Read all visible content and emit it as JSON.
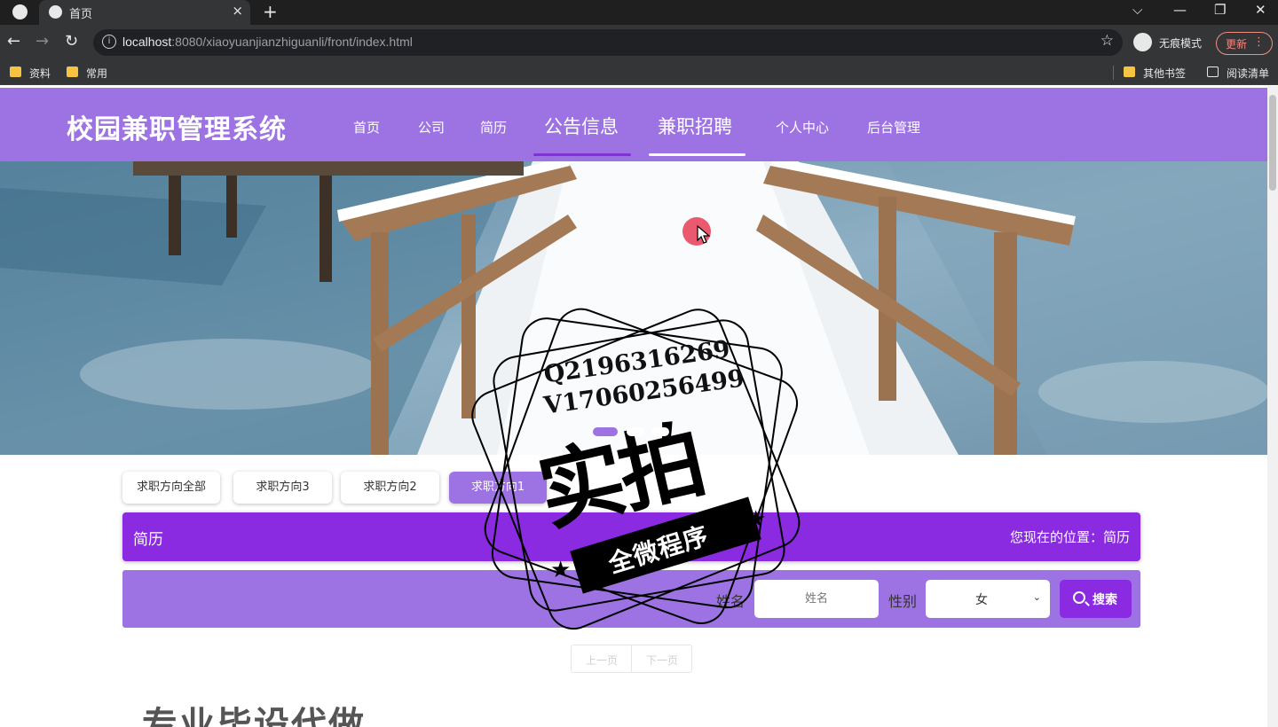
{
  "browser": {
    "tab_title": "首页",
    "tab_close": "×",
    "new_tab": "+",
    "url_host": "localhost",
    "url_rest": ":8080/xiaoyuanjianzhiguanli/front/index.html",
    "info_icon": "i",
    "star_icon": "☆",
    "incognito_label": "无痕模式",
    "update_label": "更新",
    "menu_dots": "⋮",
    "window_controls": [
      "⌵",
      "—",
      "❐",
      "✕"
    ],
    "nav": {
      "back": "←",
      "forward": "→",
      "reload": "↻"
    },
    "bookmarks_left": [
      "资料",
      "常用"
    ],
    "bookmarks_right": [
      "其他书签",
      "阅读清单"
    ]
  },
  "site": {
    "title": "校园兼职管理系统",
    "nav": [
      "首页",
      "公司",
      "简历",
      "公告信息",
      "兼职招聘",
      "个人中心",
      "后台管理"
    ],
    "accent": "#9d73e3",
    "primary": "#8a2be2"
  },
  "filters": {
    "items": [
      "求职方向全部",
      "求职方向3",
      "求职方向2",
      "求职方向1"
    ],
    "active_index": 3
  },
  "section": {
    "title": "简历",
    "location_label": "您现在的位置：简历"
  },
  "search": {
    "name_label": "姓名",
    "name_placeholder": "姓名",
    "gender_label": "性别",
    "gender_value": "女",
    "gender_caret": "⌄",
    "button_label": "搜索"
  },
  "pager": {
    "prev": "上一页",
    "next": "下一页"
  },
  "bottom_text": "专业毕设代做",
  "watermark": {
    "line1": "Q2196316269",
    "line2": "V17060256499",
    "big": "实拍",
    "ribbon": "全微程序",
    "star": "★"
  }
}
